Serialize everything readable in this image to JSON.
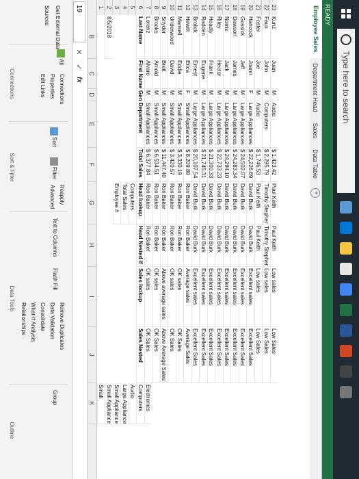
{
  "taskbar": {
    "search_placeholder": "Type here to search"
  },
  "status": "READY",
  "tabs": [
    "Employee Sales",
    "Department Head",
    "Sales",
    "Data Table"
  ],
  "active_tab": "Employee Sales",
  "name_box": "19",
  "formula_buttons": [
    "✕",
    "✓"
  ],
  "fx": "fx",
  "columns": [
    "B",
    "C",
    "D",
    "E",
    "F",
    "G",
    "H",
    "I",
    "J",
    "K"
  ],
  "ribbon": {
    "get_data": "Get External Data",
    "connections": "Connections",
    "connections_group": "Connections",
    "properties": "Properties",
    "edit_links": "Edit Links",
    "refresh_all": "All",
    "sort": "Sort",
    "filter": "Filter",
    "reapply": "Reapply",
    "advanced": "Advanced",
    "sort_filter": "Sort & Filter",
    "text_to": "Text to Columns",
    "flash_fill": "Flash Fill",
    "remove_dup": "Remove Duplicates",
    "data_val": "Data Validation",
    "consolidate": "Consolidate",
    "what_if": "What-If Analysis",
    "relationships": "Relationships",
    "group": "Group",
    "data_tools": "Data Tools",
    "outline": "Outline",
    "sources": "Sources"
  },
  "sheet": {
    "date": "8/5/2018",
    "g_block": [
      "Employee #",
      "Total Sales",
      "Computers"
    ],
    "headers": [
      "Last Name",
      "First Name",
      "Gender",
      "Department",
      "Total Sales",
      "Head lookup",
      "Head Nested If",
      "Sales lookup",
      "Sales Nested"
    ],
    "rows": [
      [
        "Lorenz",
        "Alvaro",
        "M",
        "Small Appliances",
        "$ 6,377.84",
        "Ron Baker",
        "Ron Baker",
        "OK sales",
        "OK Sales"
      ],
      [
        "Brooks",
        "Arnold",
        "M",
        "Small Appliances",
        "$ 6,534.51",
        "Ron Baker",
        "Ron Baker",
        "OK sales",
        "OK Sales"
      ],
      [
        "Snyder",
        "Brett",
        "M",
        "Small Appliances",
        "$ 11,447.40",
        "Ron Baker",
        "Ron Baker",
        "Above average sales",
        "Above Average Sales"
      ],
      [
        "Underwood",
        "David",
        "M",
        "Small Appliances",
        "$ 3,420.57",
        "Ron Baker",
        "Ron Baker",
        "OK sales",
        "OK Sales"
      ],
      [
        "Mansell",
        "Eddie",
        "M",
        "Small Appliances",
        "$ 3,330.19",
        "Ron Baker",
        "Ron Baker",
        "OK sales",
        "OK Sales"
      ],
      [
        "Hewitt",
        "Erica",
        "F",
        "Small Appliances",
        "$ 8,209.89",
        "Ron Baker",
        "Ron Baker",
        "Average sales",
        "Average Sales"
      ],
      [
        "Brolick",
        "Ernest",
        "M",
        "Large Appliances",
        "$ 20,107.54",
        "David Burk",
        "David Burk",
        "Excellent sales",
        "Excellent Sales"
      ],
      [
        "Radden",
        "Eugene",
        "M",
        "Large Appliances",
        "$ 21,745.31",
        "David Burk",
        "David Burk",
        "Excellent sales",
        "Excellent Sales"
      ],
      [
        "Headly",
        "Frank",
        "M",
        "Large Appliances",
        "$ 21,300.33",
        "David Burk",
        "David Burk",
        "Excellent sales",
        "Excellent Sales"
      ],
      [
        "Riley",
        "Hector",
        "M",
        "Large Appliances",
        "$ 22,733.23",
        "David Burk",
        "David Burk",
        "Excellent sales",
        "Excellent Sales"
      ],
      [
        "Norris",
        "Jack",
        "M",
        "Large Appliances",
        "$ 24,294.10",
        "David Burk",
        "David Burk",
        "Excellent sales",
        "Excellent Sales"
      ],
      [
        "Dawson",
        "James",
        "M",
        "Large Appliances",
        "$ 24,283.34",
        "David Burk",
        "David Burk",
        "Excellent sales",
        "Excellent Sales"
      ],
      [
        "Gossick",
        "Jeff",
        "M",
        "Large Appliances",
        "$ 24,502.07",
        "David Burk",
        "David Burk",
        "Excellent sales",
        "Excellent Sales"
      ],
      [
        "Hancock",
        "Joann",
        "F",
        "Large Appliances",
        "$ 22,226.69",
        "David Burk",
        "David Burk",
        "Excellent sales",
        "Excellent Sales"
      ],
      [
        "Foster",
        "Joe",
        "M",
        "Audio",
        "$ 1,746.53",
        "Paul Keith",
        "Paul Keith",
        "Low sales",
        "Low Sales"
      ],
      [
        "Faux",
        "John",
        "M",
        "Computers",
        "$ 2,295.79",
        "Timothy Stephens",
        "Timothy Stephens",
        "Low sales",
        "Low Sales"
      ],
      [
        "Kunz",
        "Juan",
        "M",
        "Audio",
        "$ 1,423.42",
        "Paul Keith",
        "Paul Keith",
        "Low sales",
        "Low Sales"
      ]
    ],
    "right_list": [
      "Small Appliances",
      "Small Appliances",
      "Large Appliances",
      "Audio",
      "Computers",
      "Electronics"
    ],
    "right_header": "Small"
  }
}
